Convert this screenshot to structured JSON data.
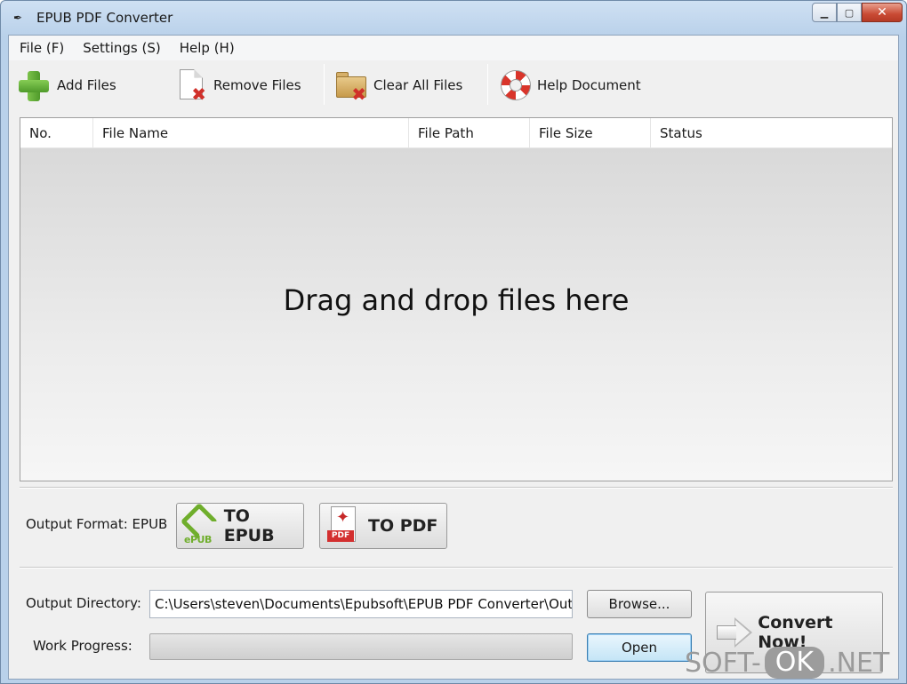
{
  "window": {
    "title": "EPUB PDF Converter",
    "app_icon": "pen-icon"
  },
  "window_controls": {
    "minimize": "minimize-icon",
    "maximize": "maximize-icon",
    "close": "close-icon"
  },
  "menu": [
    {
      "label": "File (F)"
    },
    {
      "label": "Settings (S)"
    },
    {
      "label": "Help (H)"
    }
  ],
  "toolbar": {
    "add_files": "Add Files",
    "remove_files": "Remove Files",
    "clear_all": "Clear All Files",
    "help_doc": "Help Document"
  },
  "file_list": {
    "columns": [
      "No.",
      "File Name",
      "File Path",
      "File Size",
      "Status"
    ],
    "rows": [],
    "empty_text": "Drag and drop files here"
  },
  "output_format": {
    "label": "Output Format: EPUB",
    "to_epub": "TO EPUB",
    "to_pdf": "TO PDF",
    "epub_icon_text": "ePUB",
    "pdf_icon_text": "PDF"
  },
  "output_directory": {
    "label": "Output Directory:",
    "value": "C:\\Users\\steven\\Documents\\Epubsoft\\EPUB PDF Converter\\Outp",
    "browse": "Browse..."
  },
  "progress": {
    "label": "Work Progress:",
    "value": 0,
    "open": "Open"
  },
  "convert": {
    "label": "Convert Now!"
  },
  "watermark": {
    "left": "SOFT-",
    "mid": "OK",
    "right": ".NET"
  },
  "colors": {
    "accent_green": "#6fae2c",
    "pdf_red": "#d32f2f",
    "close_red": "#c94a34"
  }
}
